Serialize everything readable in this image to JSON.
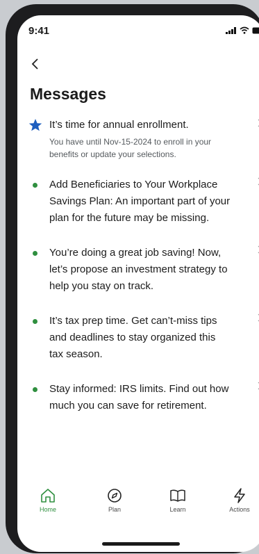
{
  "status": {
    "time": "9:41"
  },
  "page": {
    "title": "Messages"
  },
  "messages": [
    {
      "title": "It’s time for annual enrollment.",
      "subtitle_line1": "You have until Nov-15-2024 to enroll in your",
      "subtitle_line2": "benefits or update your selections.",
      "starred": true
    },
    {
      "line1": "Add Beneficiaries to Your Workplace",
      "line2": "Savings Plan: An important part of your",
      "line3": "plan for the future may be missing."
    },
    {
      "line1": "You’re doing a great job saving! Now,",
      "line2": "let’s propose an investment strategy to",
      "line3": "help you stay on track."
    },
    {
      "line1": "It’s tax prep time. Get can’t-miss tips",
      "line2": "and deadlines to stay organized this",
      "line3": "tax season."
    },
    {
      "line1": "Stay informed: IRS limits. Find out how",
      "line2": "much you can save for retirement."
    }
  ],
  "tabs": [
    {
      "label": "Home",
      "icon": "home-icon",
      "active": true
    },
    {
      "label": "Plan",
      "icon": "compass-icon"
    },
    {
      "label": "Learn",
      "icon": "book-icon"
    },
    {
      "label": "Actions",
      "icon": "lightning-icon"
    }
  ],
  "colors": {
    "accent_green": "#2f8f3f",
    "star_blue": "#1f5fbf"
  }
}
